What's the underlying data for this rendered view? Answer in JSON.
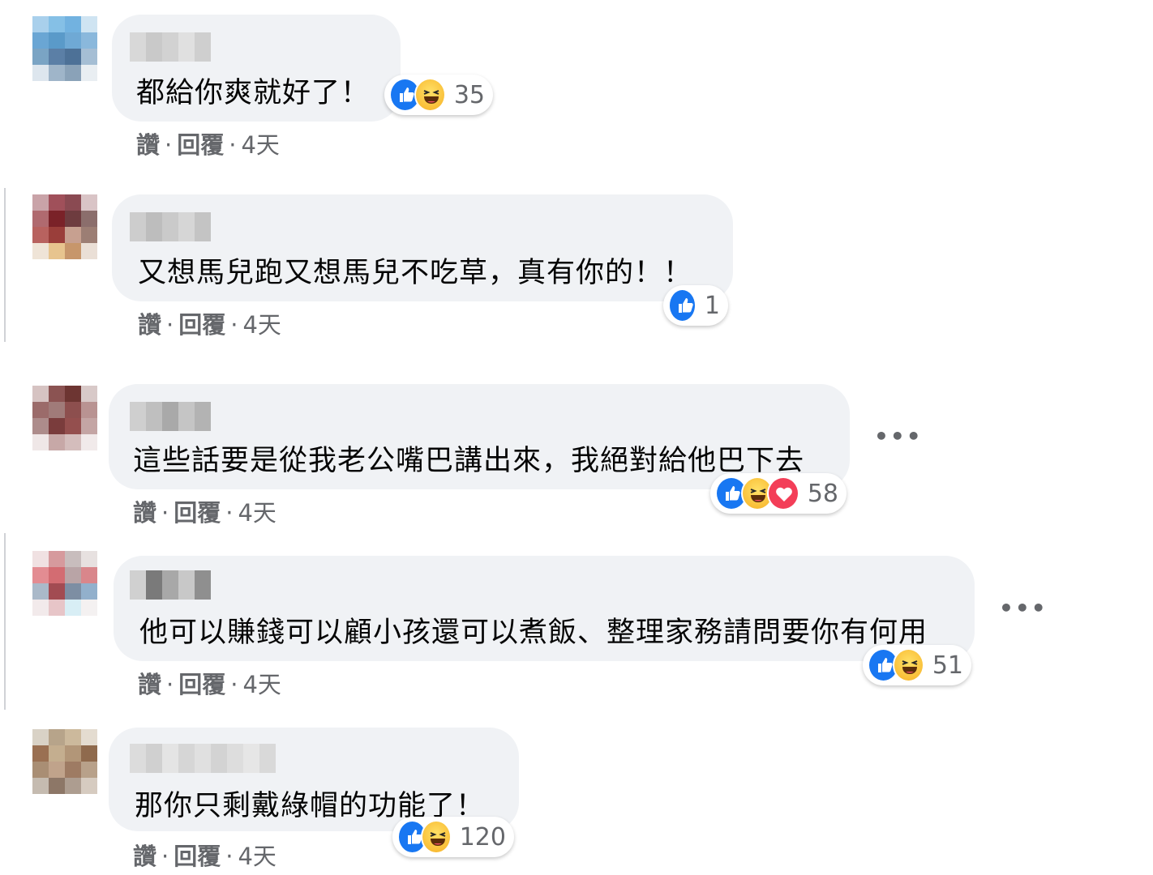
{
  "comments": [
    {
      "text": "都給你爽就好了！",
      "reaction_count": "35",
      "reactions": [
        "like-icon",
        "haha-icon"
      ],
      "actions": {
        "like": "讚",
        "reply": "回覆",
        "time": "4天"
      }
    },
    {
      "text": "又想馬兒跑又想馬兒不吃草，真有你的！！",
      "reaction_count": "1",
      "reactions": [
        "like-icon"
      ],
      "actions": {
        "like": "讚",
        "reply": "回覆",
        "time": "4天"
      }
    },
    {
      "text": "這些話要是從我老公嘴巴講出來，我絕對給他巴下去",
      "reaction_count": "58",
      "reactions": [
        "like-icon",
        "haha-icon",
        "love-icon"
      ],
      "actions": {
        "like": "讚",
        "reply": "回覆",
        "time": "4天"
      },
      "more": "•••"
    },
    {
      "text": "他可以賺錢可以顧小孩還可以煮飯、整理家務請問要你有何用",
      "reaction_count": "51",
      "reactions": [
        "like-icon",
        "haha-icon"
      ],
      "actions": {
        "like": "讚",
        "reply": "回覆",
        "time": "4天"
      },
      "more": "•••"
    },
    {
      "text": "那你只剩戴綠帽的功能了！",
      "reaction_count": "120",
      "reactions": [
        "like-icon",
        "haha-icon"
      ],
      "actions": {
        "like": "讚",
        "reply": "回覆",
        "time": "4天"
      }
    }
  ],
  "separator": "·",
  "colors": {
    "bubble": "#f0f2f5",
    "like": "#1877f2",
    "love": "#f33e58",
    "haha": "#f7b125",
    "meta": "#65676b"
  }
}
